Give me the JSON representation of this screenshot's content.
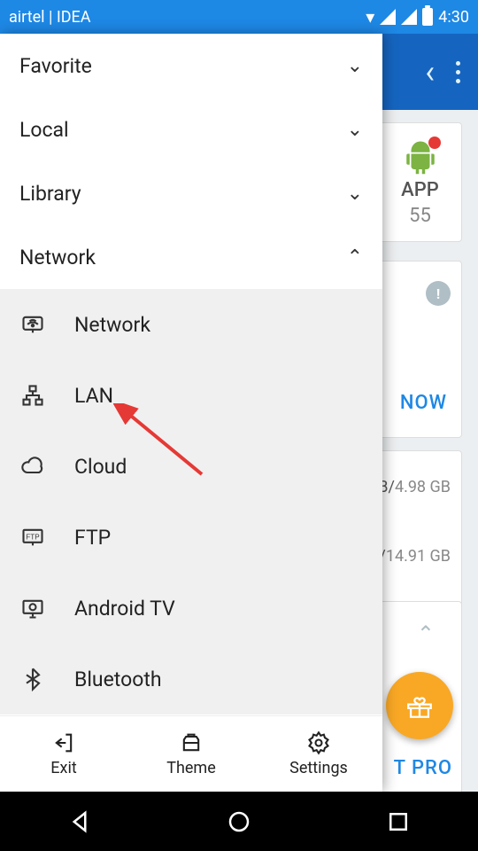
{
  "status": {
    "carrier": "airtel | IDEA",
    "time": "4:30"
  },
  "bg": {
    "app_card": {
      "label": "APP",
      "count": "55"
    },
    "promo": {
      "cta": "NOW"
    },
    "storage": {
      "row1_used": "B/",
      "row1_total": "4.98 GB",
      "row2_used": "/",
      "row2_total": "14.91 GB"
    },
    "pro": {
      "text": "T PRO"
    }
  },
  "drawer": {
    "sections": [
      {
        "label": "Favorite",
        "expanded": false
      },
      {
        "label": "Local",
        "expanded": false
      },
      {
        "label": "Library",
        "expanded": false
      },
      {
        "label": "Network",
        "expanded": true
      }
    ],
    "network_items": [
      {
        "label": "Network"
      },
      {
        "label": "LAN"
      },
      {
        "label": "Cloud"
      },
      {
        "label": "FTP"
      },
      {
        "label": "Android TV"
      },
      {
        "label": "Bluetooth"
      }
    ],
    "footer": {
      "exit": "Exit",
      "theme": "Theme",
      "settings": "Settings"
    }
  }
}
